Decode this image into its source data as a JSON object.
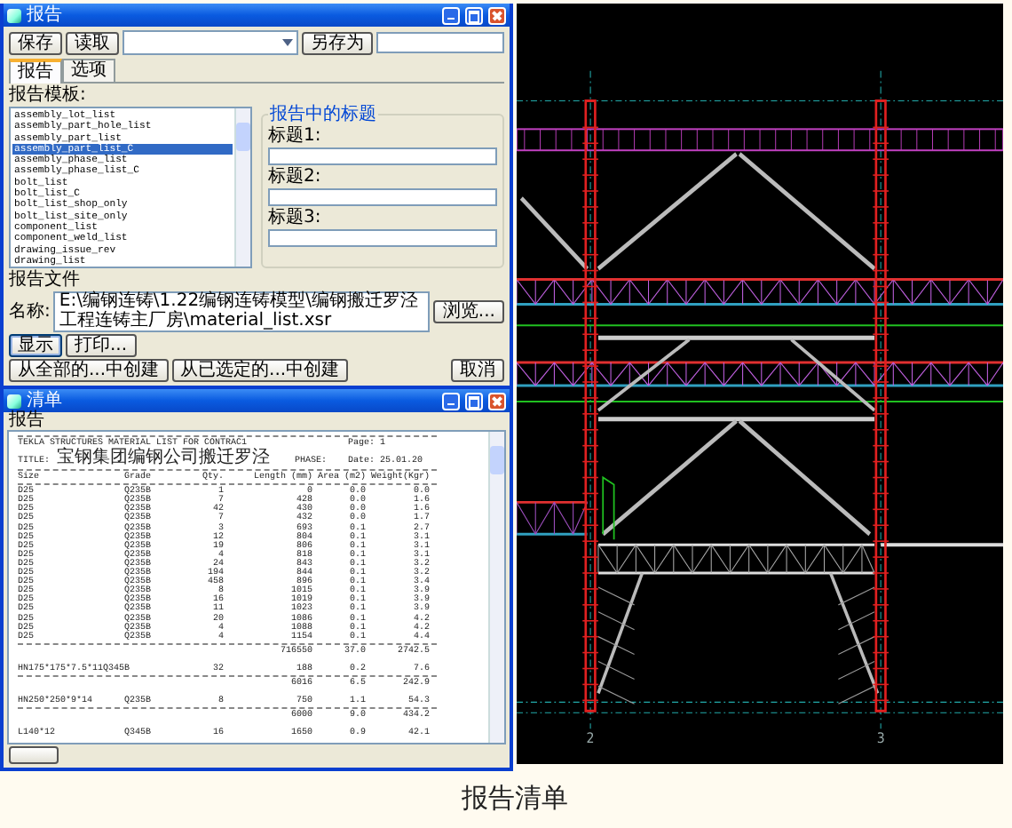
{
  "report_dialog": {
    "title": "报告",
    "save_button": "保存",
    "load_button": "读取",
    "save_as_button": "另存为",
    "tabs": [
      {
        "label": "报告",
        "selected": true
      },
      {
        "label": "选项",
        "selected": false
      }
    ],
    "templates_label": "报告模板:",
    "templates": [
      {
        "name": "assembly_lot_list",
        "selected": false
      },
      {
        "name": "assembly_part_hole_list",
        "selected": false
      },
      {
        "name": "assembly_part_list",
        "selected": false
      },
      {
        "name": "assembly_part_list_C",
        "selected": true
      },
      {
        "name": "assembly_phase_list",
        "selected": false
      },
      {
        "name": "assembly_phase_list_C",
        "selected": false
      },
      {
        "name": "bolt_list",
        "selected": false
      },
      {
        "name": "bolt_list_C",
        "selected": false
      },
      {
        "name": "bolt_list_shop_only",
        "selected": false
      },
      {
        "name": "bolt_list_site_only",
        "selected": false
      },
      {
        "name": "component_list",
        "selected": false
      },
      {
        "name": "component_weld_list",
        "selected": false
      },
      {
        "name": "drawing_issue_rev",
        "selected": false
      },
      {
        "name": "drawing_list",
        "selected": false
      }
    ],
    "titles_group": "报告中的标题",
    "title_fields": [
      "标题1:",
      "标题2:",
      "标题3:"
    ],
    "file_group": "报告文件",
    "name_label": "名称:",
    "path": "E:\\编钢连铸\\1.22编钢连铸模型\\编钢搬迁罗泾工程连铸主厂房\\material_list.xsr",
    "browse_button": "浏览...",
    "actions": [
      "显示",
      "打印..."
    ],
    "bottom_buttons": [
      "从全部的...中创建",
      "从已选定的...中创建",
      "取消"
    ]
  },
  "list_window": {
    "title": "清单",
    "menu": [
      "报告"
    ],
    "heading": "TEKLA STRUCTURES MATERIAL LIST FOR CONTRAC1",
    "page": "Page: 1",
    "title_label": "TITLE:",
    "title_value": "宝钢集团编钢公司搬迁罗泾",
    "phase": "PHASE:",
    "date": "Date: 25.01.20",
    "columns": [
      "Size",
      "Grade",
      "Qty.",
      "Length (mm)",
      "Area (m2)",
      "Weight(Kgr)"
    ],
    "rows": [
      {
        "kind": "data",
        "size": "D25",
        "grade": "Q235B",
        "qty": "1",
        "length": "0",
        "area": "0.0",
        "weight": "0.0"
      },
      {
        "kind": "data",
        "size": "D25",
        "grade": "Q235B",
        "qty": "7",
        "length": "428",
        "area": "0.0",
        "weight": "1.6"
      },
      {
        "kind": "data",
        "size": "D25",
        "grade": "Q235B",
        "qty": "42",
        "length": "430",
        "area": "0.0",
        "weight": "1.6"
      },
      {
        "kind": "data",
        "size": "D25",
        "grade": "Q235B",
        "qty": "7",
        "length": "432",
        "area": "0.0",
        "weight": "1.7"
      },
      {
        "kind": "data",
        "size": "D25",
        "grade": "Q235B",
        "qty": "3",
        "length": "693",
        "area": "0.1",
        "weight": "2.7"
      },
      {
        "kind": "data",
        "size": "D25",
        "grade": "Q235B",
        "qty": "12",
        "length": "804",
        "area": "0.1",
        "weight": "3.1"
      },
      {
        "kind": "data",
        "size": "D25",
        "grade": "Q235B",
        "qty": "19",
        "length": "806",
        "area": "0.1",
        "weight": "3.1"
      },
      {
        "kind": "data",
        "size": "D25",
        "grade": "Q235B",
        "qty": "4",
        "length": "818",
        "area": "0.1",
        "weight": "3.1"
      },
      {
        "kind": "data",
        "size": "D25",
        "grade": "Q235B",
        "qty": "24",
        "length": "843",
        "area": "0.1",
        "weight": "3.2"
      },
      {
        "kind": "data",
        "size": "D25",
        "grade": "Q235B",
        "qty": "194",
        "length": "844",
        "area": "0.1",
        "weight": "3.2"
      },
      {
        "kind": "data",
        "size": "D25",
        "grade": "Q235B",
        "qty": "458",
        "length": "896",
        "area": "0.1",
        "weight": "3.4"
      },
      {
        "kind": "data",
        "size": "D25",
        "grade": "Q235B",
        "qty": "8",
        "length": "1015",
        "area": "0.1",
        "weight": "3.9"
      },
      {
        "kind": "data",
        "size": "D25",
        "grade": "Q235B",
        "qty": "16",
        "length": "1019",
        "area": "0.1",
        "weight": "3.9"
      },
      {
        "kind": "data",
        "size": "D25",
        "grade": "Q235B",
        "qty": "11",
        "length": "1023",
        "area": "0.1",
        "weight": "3.9"
      },
      {
        "kind": "data",
        "size": "D25",
        "grade": "Q235B",
        "qty": "20",
        "length": "1086",
        "area": "0.1",
        "weight": "4.2"
      },
      {
        "kind": "data",
        "size": "D25",
        "grade": "Q235B",
        "qty": "4",
        "length": "1088",
        "area": "0.1",
        "weight": "4.2"
      },
      {
        "kind": "data",
        "size": "D25",
        "grade": "Q235B",
        "qty": "4",
        "length": "1154",
        "area": "0.1",
        "weight": "4.4"
      },
      {
        "kind": "rule"
      },
      {
        "kind": "total",
        "length": "716550",
        "area": "37.0",
        "weight": "2742.5"
      },
      {
        "kind": "blank"
      },
      {
        "kind": "data",
        "size": "HN175*175*7.5*11Q345B",
        "qty": "32",
        "length": "188",
        "area": "0.2",
        "weight": "7.6"
      },
      {
        "kind": "rule"
      },
      {
        "kind": "total",
        "length": "6016",
        "area": "6.5",
        "weight": "242.9"
      },
      {
        "kind": "blank"
      },
      {
        "kind": "data",
        "size": "HN250*250*9*14",
        "grade": "Q235B",
        "qty": "8",
        "length": "750",
        "area": "1.1",
        "weight": "54.3"
      },
      {
        "kind": "rule"
      },
      {
        "kind": "total",
        "length": "6000",
        "area": "9.0",
        "weight": "434.2"
      },
      {
        "kind": "blank"
      },
      {
        "kind": "data",
        "size": "L140*12",
        "grade": "Q345B",
        "qty": "16",
        "length": "1650",
        "area": "0.9",
        "weight": "42.1"
      }
    ]
  },
  "model_view": {
    "grid_labels": [
      "2",
      "3"
    ]
  },
  "caption": "报告清单"
}
